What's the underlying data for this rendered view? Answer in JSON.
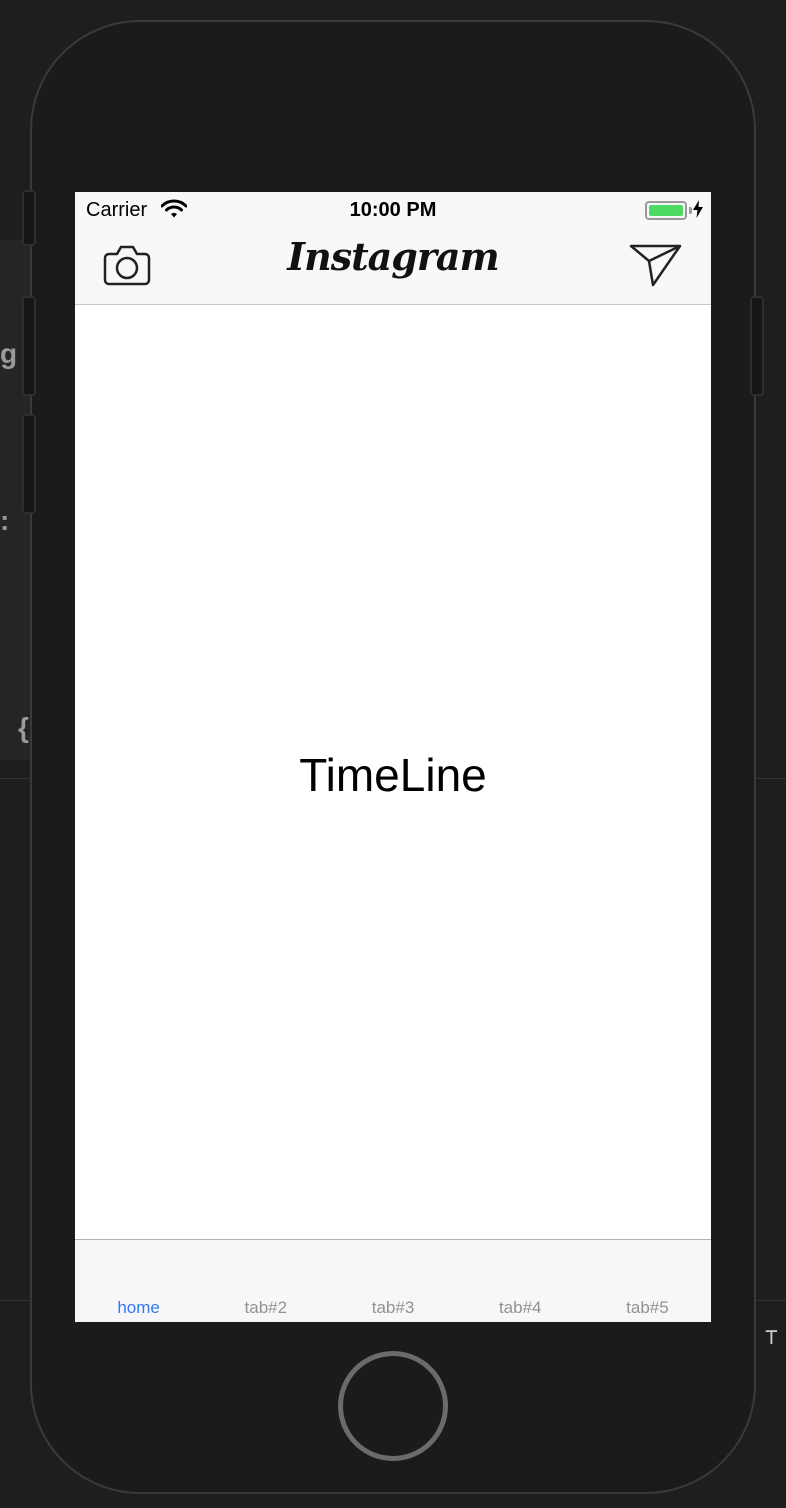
{
  "status_bar": {
    "carrier": "Carrier",
    "time": "10:00 PM",
    "wifi_icon": "wifi-icon",
    "battery_icon": "battery-full-icon",
    "charging_icon": "bolt-icon",
    "battery_color": "#4cd964"
  },
  "nav_bar": {
    "left_icon": "camera-icon",
    "title": "Instagram",
    "right_icon": "send-icon"
  },
  "content": {
    "label": "TimeLine"
  },
  "tab_bar": {
    "active_color": "#3478f6",
    "inactive_color": "#929292",
    "items": [
      {
        "label": "home"
      },
      {
        "label": "tab#2"
      },
      {
        "label": "tab#3"
      },
      {
        "label": "tab#4"
      },
      {
        "label": "tab#5"
      }
    ]
  },
  "background": {
    "glyphs": [
      "g",
      ":",
      "{",
      "⊤"
    ]
  }
}
